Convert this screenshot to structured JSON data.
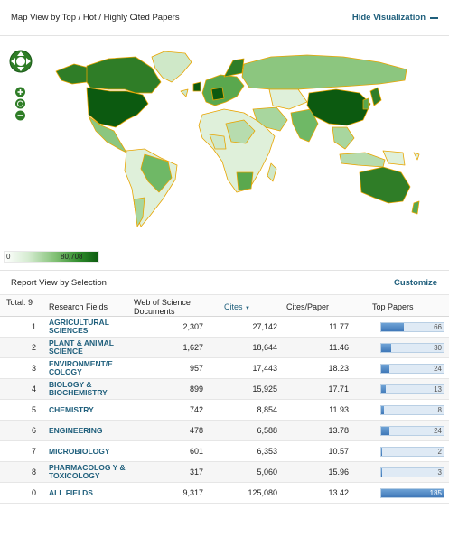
{
  "header": {
    "map_title": "Map View by Top / Hot / Highly Cited Papers",
    "hide_visualization": "Hide Visualization"
  },
  "legend": {
    "min": "0",
    "max": "80,708"
  },
  "colors": {
    "link": "#1f5f7c",
    "map_dark": "#0c5a10",
    "map_border": "#e8a400",
    "bar": "#3f78b8"
  },
  "report": {
    "title": "Report View by Selection",
    "customize": "Customize",
    "columns": {
      "total": "Total: 9",
      "fields": "Research Fields",
      "wos": "Web of Science Documents",
      "cites": "Cites",
      "cites_paper": "Cites/Paper",
      "top_papers": "Top Papers"
    },
    "rows": [
      {
        "idx": "1",
        "field": "AGRICULTURAL SCIENCES",
        "wos": "2,307",
        "cites": "27,142",
        "cpp": "11.77",
        "top": "66",
        "ratio": 0.36
      },
      {
        "idx": "2",
        "field": "PLANT & ANIMAL SCIENCE",
        "wos": "1,627",
        "cites": "18,644",
        "cpp": "11.46",
        "top": "30",
        "ratio": 0.16
      },
      {
        "idx": "3",
        "field": "ENVIRONMENT/E COLOGY",
        "wos": "957",
        "cites": "17,443",
        "cpp": "18.23",
        "top": "24",
        "ratio": 0.13
      },
      {
        "idx": "4",
        "field": "BIOLOGY & BIOCHEMISTRY",
        "wos": "899",
        "cites": "15,925",
        "cpp": "17.71",
        "top": "13",
        "ratio": 0.07
      },
      {
        "idx": "5",
        "field": "CHEMISTRY",
        "wos": "742",
        "cites": "8,854",
        "cpp": "11.93",
        "top": "8",
        "ratio": 0.043
      },
      {
        "idx": "6",
        "field": "ENGINEERING",
        "wos": "478",
        "cites": "6,588",
        "cpp": "13.78",
        "top": "24",
        "ratio": 0.13
      },
      {
        "idx": "7",
        "field": "MICROBIOLOGY",
        "wos": "601",
        "cites": "6,353",
        "cpp": "10.57",
        "top": "2",
        "ratio": 0.011
      },
      {
        "idx": "8",
        "field": "PHARMACOLOG Y & TOXICOLOGY",
        "wos": "317",
        "cites": "5,060",
        "cpp": "15.96",
        "top": "3",
        "ratio": 0.016
      },
      {
        "idx": "0",
        "field": "ALL FIELDS",
        "wos": "9,317",
        "cites": "125,080",
        "cpp": "13.42",
        "top": "185",
        "ratio": 1.0
      }
    ]
  }
}
